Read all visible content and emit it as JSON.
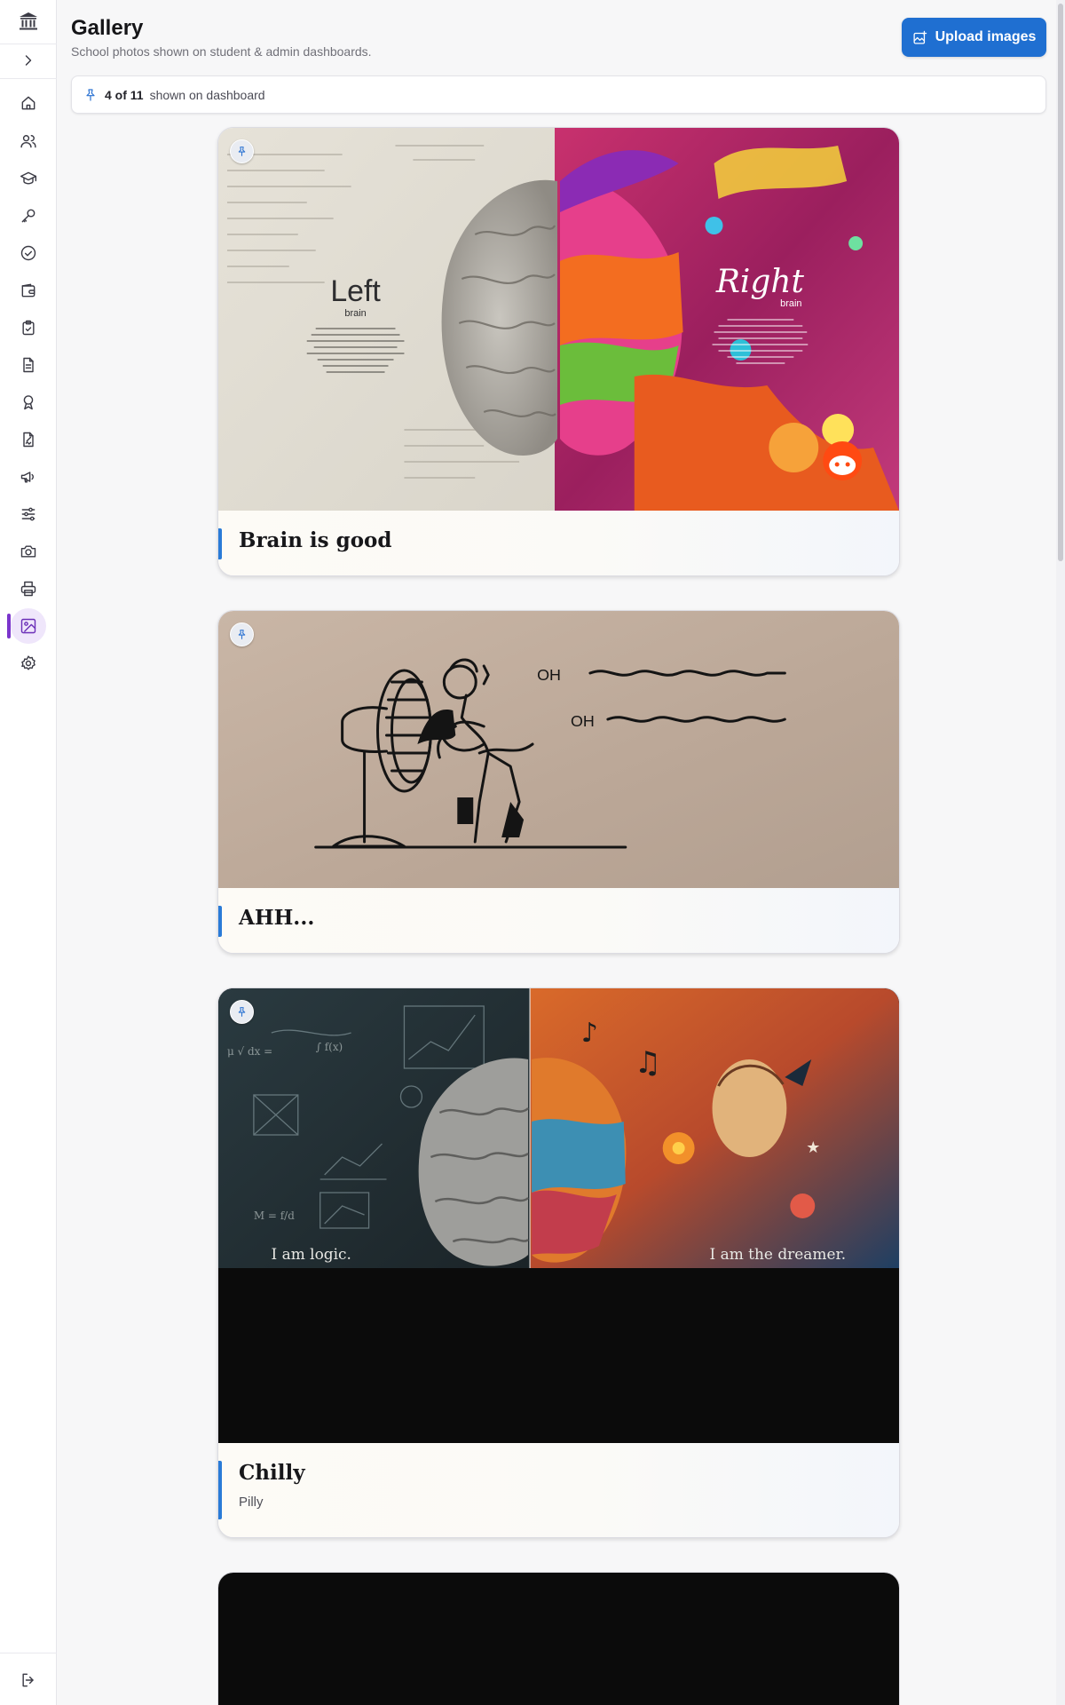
{
  "sidebar": {
    "items": [
      {
        "icon": "home-icon"
      },
      {
        "icon": "users-icon"
      },
      {
        "icon": "graduation-cap-icon"
      },
      {
        "icon": "key-icon"
      },
      {
        "icon": "check-circle-icon"
      },
      {
        "icon": "wallet-icon"
      },
      {
        "icon": "clipboard-check-icon"
      },
      {
        "icon": "document-icon"
      },
      {
        "icon": "award-icon"
      },
      {
        "icon": "file-signature-icon"
      },
      {
        "icon": "megaphone-icon"
      },
      {
        "icon": "sliders-icon"
      },
      {
        "icon": "camera-icon"
      },
      {
        "icon": "printer-icon"
      },
      {
        "icon": "gallery-icon",
        "active": true
      },
      {
        "icon": "settings-icon"
      }
    ],
    "accent_color": "#7b35cc"
  },
  "header": {
    "title": "Gallery",
    "subtitle": "School photos shown on student & admin dashboards.",
    "upload_label": "Upload images"
  },
  "pinned": {
    "count": "4 of 11",
    "text": "shown on dashboard"
  },
  "cards": [
    {
      "title": "Brain is good",
      "description": "",
      "image": {
        "left_word": "Left",
        "left_sub": "brain",
        "right_word": "Right",
        "right_sub": "brain"
      },
      "pinned": true
    },
    {
      "title": "AHH...",
      "description": "",
      "image": {
        "shout_1": "OH",
        "shout_2": "OH"
      },
      "pinned": true
    },
    {
      "title": "Chilly",
      "description": "Pilly",
      "image": {
        "left_caption": "I am logic.",
        "right_caption": "I am the dreamer."
      },
      "pinned": true
    },
    {
      "title": "",
      "description": "",
      "image": {},
      "pinned": false
    }
  ],
  "colors": {
    "primary": "#1f6fd1",
    "pin": "#2c73d2",
    "card_accent": "#2a7bd7"
  }
}
